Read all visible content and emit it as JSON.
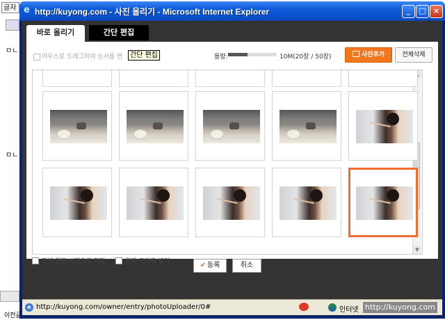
{
  "background_page": {
    "top_button_label": "글자",
    "side_label_1": "ㅁㄴ",
    "side_label_2": "ㅁㄴ",
    "bottom_label": "이전글 보기"
  },
  "window": {
    "title": "http://kuyong.com - 사진 올리기 - Microsoft Internet Explorer",
    "controls": {
      "minimize": "_",
      "maximize": "□",
      "close": "×"
    }
  },
  "tabs": [
    {
      "label": "바로 올리기",
      "active": true
    },
    {
      "label": "간단 편집",
      "active": false
    }
  ],
  "toolbar": {
    "drag_hint": "마우스로 드래그하여 순서를 변",
    "tooltip": "간단 편집",
    "capacity_label": "용량:",
    "capacity_value": "10M(20장 / 50장)",
    "capacity_fraction": 0.4,
    "add_photo_button": "사진추가",
    "delete_all_button": "전체삭제"
  },
  "photos": [
    {
      "kind": "kitchen",
      "selected": false
    },
    {
      "kind": "kitchen",
      "selected": false
    },
    {
      "kind": "kitchen",
      "selected": false
    },
    {
      "kind": "kitchen",
      "selected": false
    },
    {
      "kind": "person",
      "selected": false
    },
    {
      "kind": "person",
      "selected": false
    },
    {
      "kind": "person",
      "selected": false
    },
    {
      "kind": "person",
      "selected": false
    },
    {
      "kind": "person",
      "selected": false
    },
    {
      "kind": "person",
      "selected": true
    }
  ],
  "options": {
    "save_original": "전체 원본 사진으로 저장",
    "original_size": "원본 크기로 넣기"
  },
  "actions": {
    "register": "등록",
    "cancel": "취소"
  },
  "statusbar": {
    "url": "http://kuyong.com/owner/entry/photoUploader/0#",
    "zone": "인터넷",
    "watermark": "http://kuyong.com"
  },
  "colors": {
    "accent_orange": "#f36b2e",
    "titlebar_blue": "#0b5ad8",
    "frame_dark": "#333333"
  }
}
